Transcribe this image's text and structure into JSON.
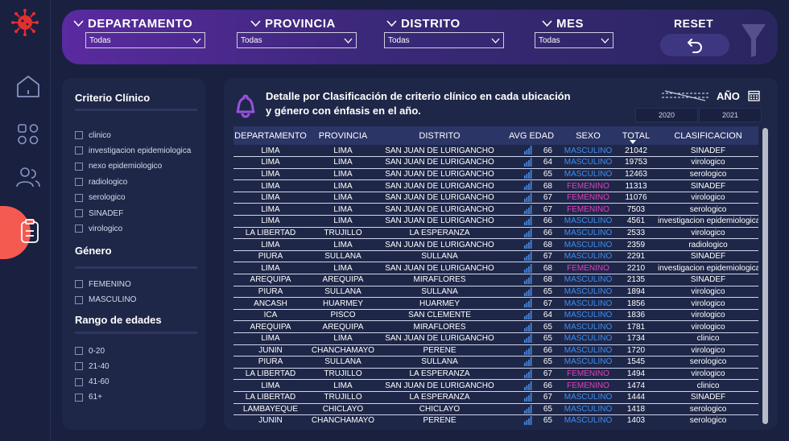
{
  "filters": [
    {
      "label": "DEPARTAMENTO",
      "value": "Todas"
    },
    {
      "label": "PROVINCIA",
      "value": "Todas"
    },
    {
      "label": "DISTRITO",
      "value": "Todas"
    },
    {
      "label": "MES",
      "value": "Todas"
    }
  ],
  "reset": {
    "label": "RESET"
  },
  "sidebar": {
    "criterio_title": "Criterio Clínico",
    "criterio_items": [
      "clinico",
      "investigacion epidemiologica",
      "nexo epidemiologico",
      "radiologico",
      "serologico",
      "SINADEF",
      "virologico"
    ],
    "genero_title": "Género",
    "genero_items": [
      "FEMENINO",
      "MASCULINO"
    ],
    "edades_title": "Rango de edades",
    "edades_items": [
      "0-20",
      "21-40",
      "41-60",
      "61+"
    ]
  },
  "main": {
    "title": "Detalle por Clasificación de criterio clínico en cada ubicación y  género con énfasis en el año.",
    "anio_label": "AÑO",
    "years": [
      "2020",
      "2021"
    ]
  },
  "colors": {
    "masculino": "#3d8ef0",
    "femenino": "#e040c0",
    "accent": "#f55a50"
  },
  "table": {
    "columns": [
      "DEPARTAMENTO",
      "PROVINCIA",
      "DISTRITO",
      "AVG EDAD",
      "SEXO",
      "TOTAL",
      "CLASIFICACION"
    ],
    "rows": [
      [
        "LIMA",
        "LIMA",
        "SAN JUAN DE LURIGANCHO",
        "66",
        "MASCULINO",
        "21042",
        "SINADEF"
      ],
      [
        "LIMA",
        "LIMA",
        "SAN JUAN DE LURIGANCHO",
        "64",
        "MASCULINO",
        "19753",
        "virologico"
      ],
      [
        "LIMA",
        "LIMA",
        "SAN JUAN DE LURIGANCHO",
        "65",
        "MASCULINO",
        "12463",
        "serologico"
      ],
      [
        "LIMA",
        "LIMA",
        "SAN JUAN DE LURIGANCHO",
        "68",
        "FEMENINO",
        "11313",
        "SINADEF"
      ],
      [
        "LIMA",
        "LIMA",
        "SAN JUAN DE LURIGANCHO",
        "67",
        "FEMENINO",
        "11076",
        "virologico"
      ],
      [
        "LIMA",
        "LIMA",
        "SAN JUAN DE LURIGANCHO",
        "67",
        "FEMENINO",
        "7503",
        "serologico"
      ],
      [
        "LIMA",
        "LIMA",
        "SAN JUAN DE LURIGANCHO",
        "66",
        "MASCULINO",
        "4561",
        "investigacion epidemiologica"
      ],
      [
        "LA LIBERTAD",
        "TRUJILLO",
        "LA ESPERANZA",
        "66",
        "MASCULINO",
        "2533",
        "virologico"
      ],
      [
        "LIMA",
        "LIMA",
        "SAN JUAN DE LURIGANCHO",
        "68",
        "MASCULINO",
        "2359",
        "radiologico"
      ],
      [
        "PIURA",
        "SULLANA",
        "SULLANA",
        "67",
        "MASCULINO",
        "2291",
        "SINADEF"
      ],
      [
        "LIMA",
        "LIMA",
        "SAN JUAN DE LURIGANCHO",
        "68",
        "FEMENINO",
        "2210",
        "investigacion epidemiologica"
      ],
      [
        "AREQUIPA",
        "AREQUIPA",
        "MIRAFLORES",
        "68",
        "MASCULINO",
        "2135",
        "SINADEF"
      ],
      [
        "PIURA",
        "SULLANA",
        "SULLANA",
        "65",
        "MASCULINO",
        "1894",
        "virologico"
      ],
      [
        "ANCASH",
        "HUARMEY",
        "HUARMEY",
        "67",
        "MASCULINO",
        "1856",
        "virologico"
      ],
      [
        "ICA",
        "PISCO",
        "SAN CLEMENTE",
        "64",
        "MASCULINO",
        "1836",
        "virologico"
      ],
      [
        "AREQUIPA",
        "AREQUIPA",
        "MIRAFLORES",
        "65",
        "MASCULINO",
        "1781",
        "virologico"
      ],
      [
        "LIMA",
        "LIMA",
        "SAN JUAN DE LURIGANCHO",
        "65",
        "MASCULINO",
        "1734",
        "clinico"
      ],
      [
        "JUNIN",
        "CHANCHAMAYO",
        "PERENE",
        "66",
        "MASCULINO",
        "1720",
        "virologico"
      ],
      [
        "PIURA",
        "SULLANA",
        "SULLANA",
        "65",
        "MASCULINO",
        "1545",
        "serologico"
      ],
      [
        "LA LIBERTAD",
        "TRUJILLO",
        "LA ESPERANZA",
        "67",
        "FEMENINO",
        "1494",
        "virologico"
      ],
      [
        "LIMA",
        "LIMA",
        "SAN JUAN DE LURIGANCHO",
        "66",
        "FEMENINO",
        "1474",
        "clinico"
      ],
      [
        "LA LIBERTAD",
        "TRUJILLO",
        "LA ESPERANZA",
        "67",
        "MASCULINO",
        "1444",
        "SINADEF"
      ],
      [
        "LAMBAYEQUE",
        "CHICLAYO",
        "CHICLAYO",
        "65",
        "MASCULINO",
        "1418",
        "serologico"
      ],
      [
        "JUNIN",
        "CHANCHAMAYO",
        "PERENE",
        "65",
        "MASCULINO",
        "1403",
        "serologico"
      ]
    ]
  }
}
